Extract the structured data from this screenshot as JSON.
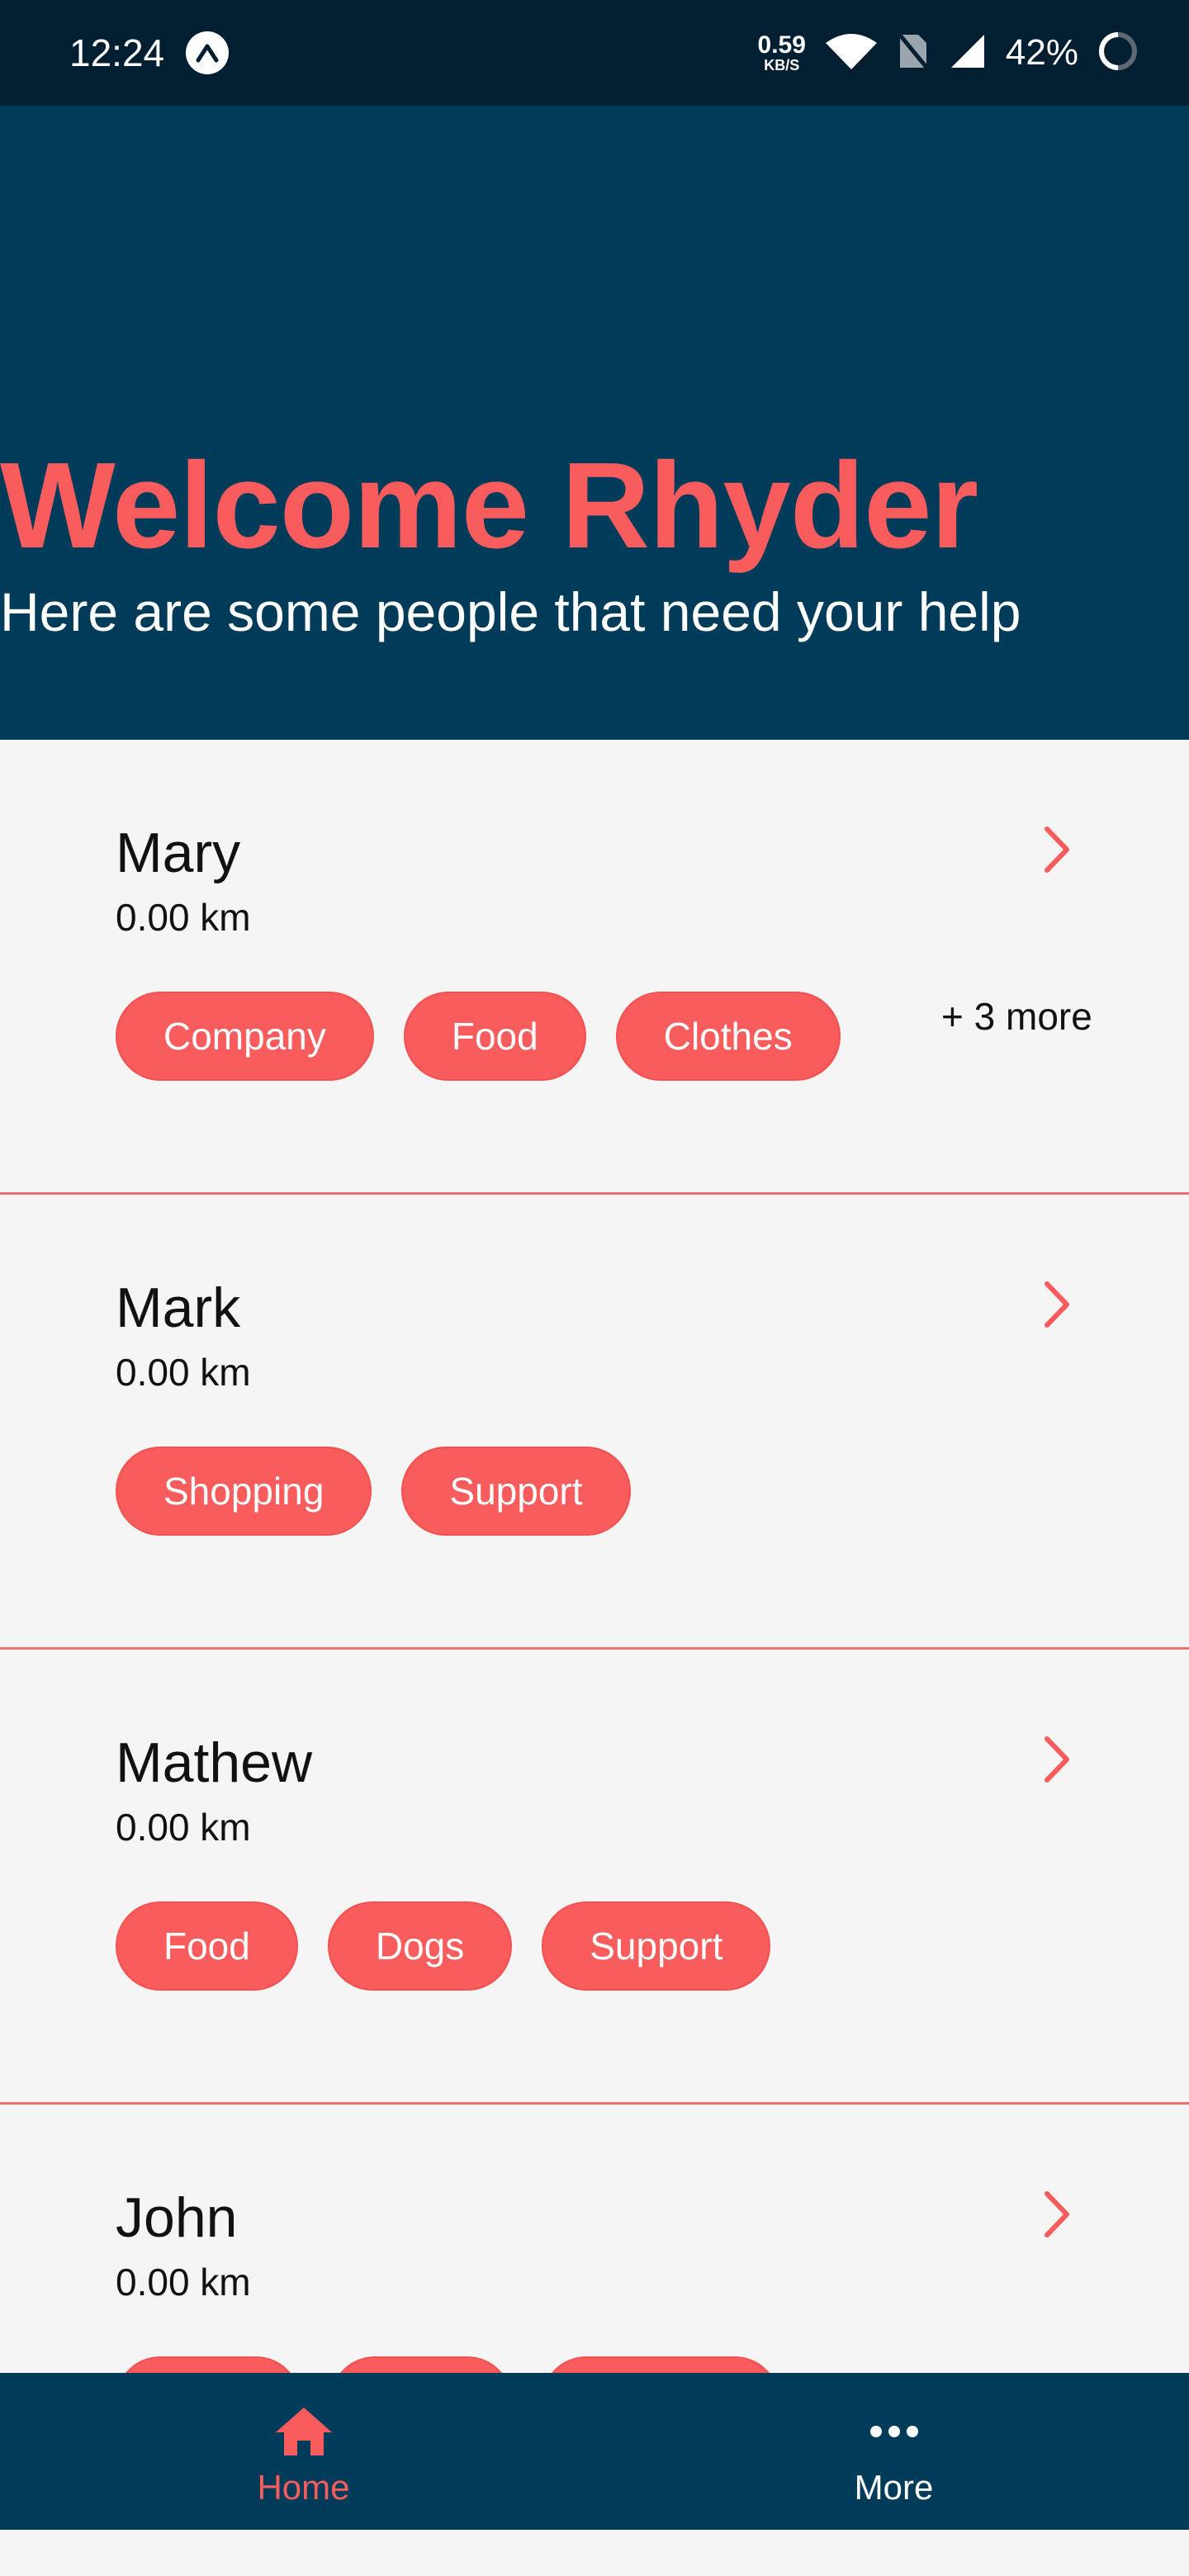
{
  "status_bar": {
    "time": "12:24",
    "net_speed_value": "0.59",
    "net_speed_unit": "KB/S",
    "battery_text": "42%",
    "icons": [
      "app-a-icon",
      "wifi-icon",
      "no-sim-icon",
      "cellular-signal-icon",
      "battery-ring-icon"
    ]
  },
  "header": {
    "title": "Welcome Rhyder",
    "subtitle": "Here are some people that need your help"
  },
  "people": [
    {
      "name": "Mary",
      "distance": "0.00 km",
      "tags": [
        "Company",
        "Food",
        "Clothes"
      ],
      "more": "+ 3 more"
    },
    {
      "name": "Mark",
      "distance": "0.00 km",
      "tags": [
        "Shopping",
        "Support"
      ],
      "more": ""
    },
    {
      "name": "Mathew",
      "distance": "0.00 km",
      "tags": [
        "Food",
        "Dogs",
        "Support"
      ],
      "more": ""
    },
    {
      "name": "John",
      "distance": "0.00 km",
      "tags": [
        "",
        "",
        ""
      ],
      "more": ""
    }
  ],
  "bottom_nav": {
    "home_label": "Home",
    "more_label": "More"
  },
  "colors": {
    "accent": "#f95c5c",
    "header_bg": "#003b59",
    "status_bg": "#021f32",
    "page_bg": "#f5f5f5"
  }
}
